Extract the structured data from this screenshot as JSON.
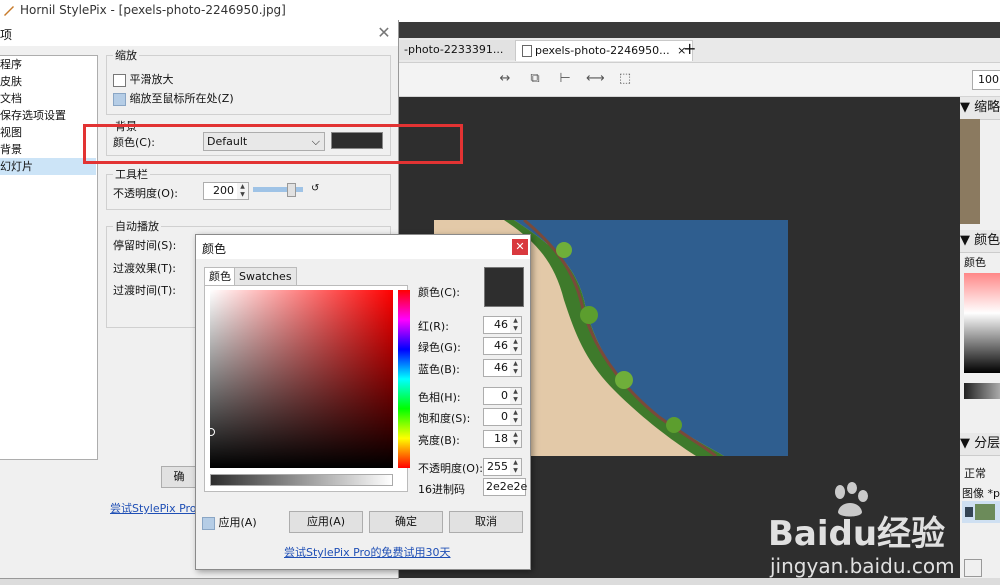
{
  "app": {
    "title": "Hornil StylePix - [pexels-photo-2246950.jpg]"
  },
  "tabs": [
    {
      "label": "-photo-2233391..."
    },
    {
      "label": "pexels-photo-2246950..."
    }
  ],
  "tab_close": "×",
  "tab_add": "+",
  "zoom": "100",
  "right_panel": {
    "thumbnail": "缩略",
    "color": "颜色",
    "color_tab": "颜色",
    "layers": "分层",
    "blend": "正常",
    "layer_name": "图像 *pe"
  },
  "options_dialog": {
    "title": "项",
    "close": "✕",
    "nav_items": [
      "程序",
      "皮肤",
      "文档",
      "保存选项设置",
      "视图",
      "背景",
      "幻灯片"
    ],
    "nav_selected": 6,
    "zoom_group": {
      "title": "缩放",
      "smooth_label": "平滑放大",
      "smooth_checked": false,
      "zoom_to_mouse_label": "缩放至鼠标所在处(Z)",
      "zoom_to_mouse_checked": true
    },
    "background_group": {
      "title": "背景",
      "color_label": "颜色(C):",
      "color_value": "Default",
      "swatch": "#2e2e2e"
    },
    "toolbar_group": {
      "title": "工具栏",
      "opacity_label": "不透明度(O):",
      "opacity_value": "200"
    },
    "autoplay_group": {
      "title": "自动播放",
      "stay_label": "停留时间(S):",
      "transition_label": "过渡效果(T):",
      "transition_time_label": "过渡时间(T):"
    },
    "ok_partial": "确",
    "link_partial": "尝试StylePix ProE"
  },
  "color_dialog": {
    "title": "颜色",
    "close": "✕",
    "tabs": [
      "颜色",
      "Swatches"
    ],
    "color_label": "颜色(C):",
    "current": "#2e2e2e",
    "fields": [
      {
        "label": "红(R):",
        "value": "46"
      },
      {
        "label": "绿色(G):",
        "value": "46"
      },
      {
        "label": "蓝色(B):",
        "value": "46"
      },
      {
        "label": "色相(H):",
        "value": "0"
      },
      {
        "label": "饱和度(S):",
        "value": "0"
      },
      {
        "label": "亮度(B):",
        "value": "18"
      },
      {
        "label": "不透明度(O):",
        "value": "255"
      }
    ],
    "hex_label": "16进制码",
    "hex_value": "2e2e2e",
    "apply_check_label": "应用(A)",
    "apply_check_checked": true,
    "buttons": {
      "apply": "应用(A)",
      "ok": "确定",
      "cancel": "取消"
    },
    "link": "尝试StylePix Pro的免费试用30天"
  },
  "watermark": {
    "brand": "Baidu经验",
    "url": "jingyan.baidu.com"
  }
}
